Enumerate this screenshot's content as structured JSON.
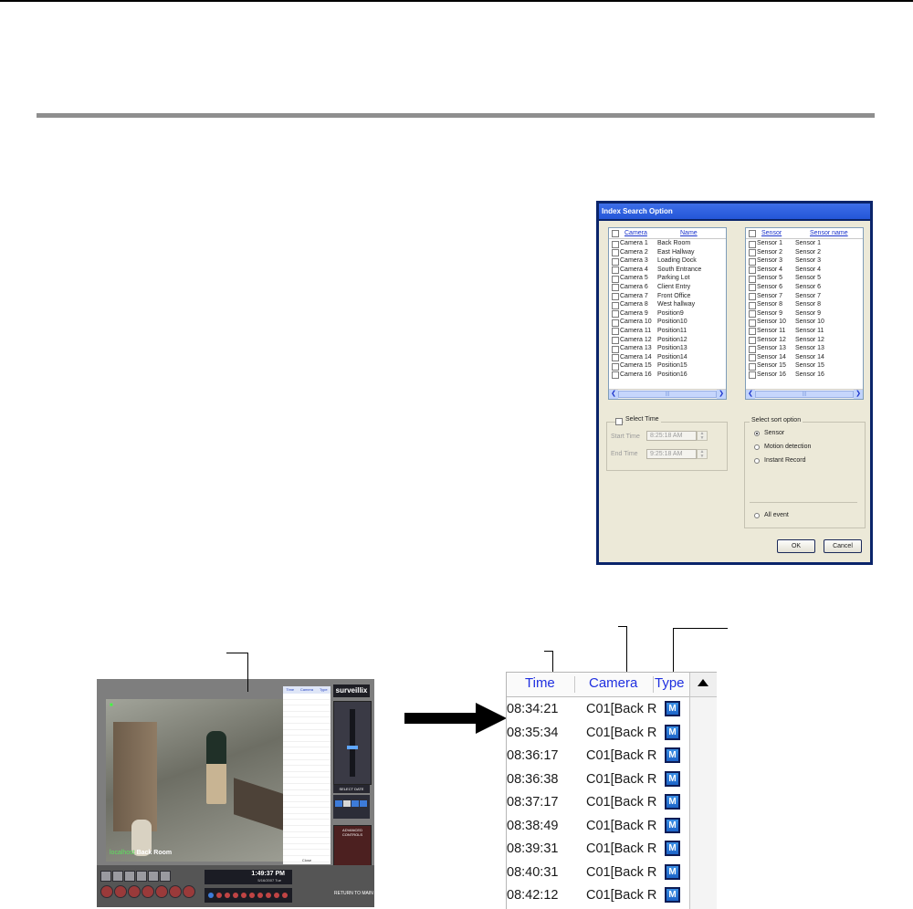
{
  "dialog": {
    "title": "Index Search Option",
    "camera_list": {
      "col_camera": "Camera",
      "col_name": "Name",
      "rows": [
        {
          "camera": "Camera 1",
          "name": "Back Room"
        },
        {
          "camera": "Camera 2",
          "name": "East Hallway"
        },
        {
          "camera": "Camera 3",
          "name": "Loading Dock"
        },
        {
          "camera": "Camera 4",
          "name": "South Entrance"
        },
        {
          "camera": "Camera 5",
          "name": "Parking Lot"
        },
        {
          "camera": "Camera 6",
          "name": "Client Entry"
        },
        {
          "camera": "Camera 7",
          "name": "Front Office"
        },
        {
          "camera": "Camera 8",
          "name": "West hallway"
        },
        {
          "camera": "Camera 9",
          "name": "Position9"
        },
        {
          "camera": "Camera 10",
          "name": "Position10"
        },
        {
          "camera": "Camera 11",
          "name": "Position11"
        },
        {
          "camera": "Camera 12",
          "name": "Position12"
        },
        {
          "camera": "Camera 13",
          "name": "Position13"
        },
        {
          "camera": "Camera 14",
          "name": "Position14"
        },
        {
          "camera": "Camera 15",
          "name": "Position15"
        },
        {
          "camera": "Camera 16",
          "name": "Position16"
        }
      ]
    },
    "sensor_list": {
      "col_sensor": "Sensor",
      "col_name": "Sensor name",
      "rows": [
        {
          "sensor": "Sensor 1",
          "name": "Sensor 1"
        },
        {
          "sensor": "Sensor 2",
          "name": "Sensor 2"
        },
        {
          "sensor": "Sensor 3",
          "name": "Sensor 3"
        },
        {
          "sensor": "Sensor 4",
          "name": "Sensor 4"
        },
        {
          "sensor": "Sensor 5",
          "name": "Sensor 5"
        },
        {
          "sensor": "Sensor 6",
          "name": "Sensor 6"
        },
        {
          "sensor": "Sensor 7",
          "name": "Sensor 7"
        },
        {
          "sensor": "Sensor 8",
          "name": "Sensor 8"
        },
        {
          "sensor": "Sensor 9",
          "name": "Sensor 9"
        },
        {
          "sensor": "Sensor 10",
          "name": "Sensor 10"
        },
        {
          "sensor": "Sensor 11",
          "name": "Sensor 11"
        },
        {
          "sensor": "Sensor 12",
          "name": "Sensor 12"
        },
        {
          "sensor": "Sensor 13",
          "name": "Sensor 13"
        },
        {
          "sensor": "Sensor 14",
          "name": "Sensor 14"
        },
        {
          "sensor": "Sensor 15",
          "name": "Sensor 15"
        },
        {
          "sensor": "Sensor 16",
          "name": "Sensor 16"
        }
      ]
    },
    "select_time": {
      "label": "Select Time",
      "start_label": "Start Time",
      "start_value": "8:25:18 AM",
      "end_label": "End Time",
      "end_value": "9:25:18 AM"
    },
    "sort_option": {
      "label": "Select sort option",
      "options": [
        "Sensor",
        "Motion detection",
        "Instant Record"
      ],
      "selected": "Sensor",
      "all_event": "All event"
    },
    "ok_label": "OK",
    "cancel_label": "Cancel"
  },
  "dvr": {
    "logo": "surveillix",
    "camera_label_prefix": "localhost",
    "camera_label_name": "Back Room",
    "event_list_cols": [
      "Time",
      "Camera",
      "Type"
    ],
    "close_label": "Close",
    "select_date": "SELECT DATE",
    "advanced_controls": "ADVANCED CONTROLS",
    "clock_time": "1:49:37 PM",
    "clock_date": "5/16/2007 Tue",
    "return_label": "RETURN TO MAIN"
  },
  "event_list": {
    "col_time": "Time",
    "col_camera": "Camera",
    "col_type": "Type",
    "rows": [
      {
        "time": "08:34:21",
        "camera": "C01[Back R",
        "type": "M"
      },
      {
        "time": "08:35:34",
        "camera": "C01[Back R",
        "type": "M"
      },
      {
        "time": "08:36:17",
        "camera": "C01[Back R",
        "type": "M"
      },
      {
        "time": "08:36:38",
        "camera": "C01[Back R",
        "type": "M"
      },
      {
        "time": "08:37:17",
        "camera": "C01[Back R",
        "type": "M"
      },
      {
        "time": "08:38:49",
        "camera": "C01[Back R",
        "type": "M"
      },
      {
        "time": "08:39:31",
        "camera": "C01[Back R",
        "type": "M"
      },
      {
        "time": "08:40:31",
        "camera": "C01[Back R",
        "type": "M"
      },
      {
        "time": "08:42:12",
        "camera": "C01[Back R",
        "type": "M"
      }
    ]
  },
  "colors": {
    "accent_blue": "#2030e0",
    "rule_gray": "#8e8e8e"
  }
}
